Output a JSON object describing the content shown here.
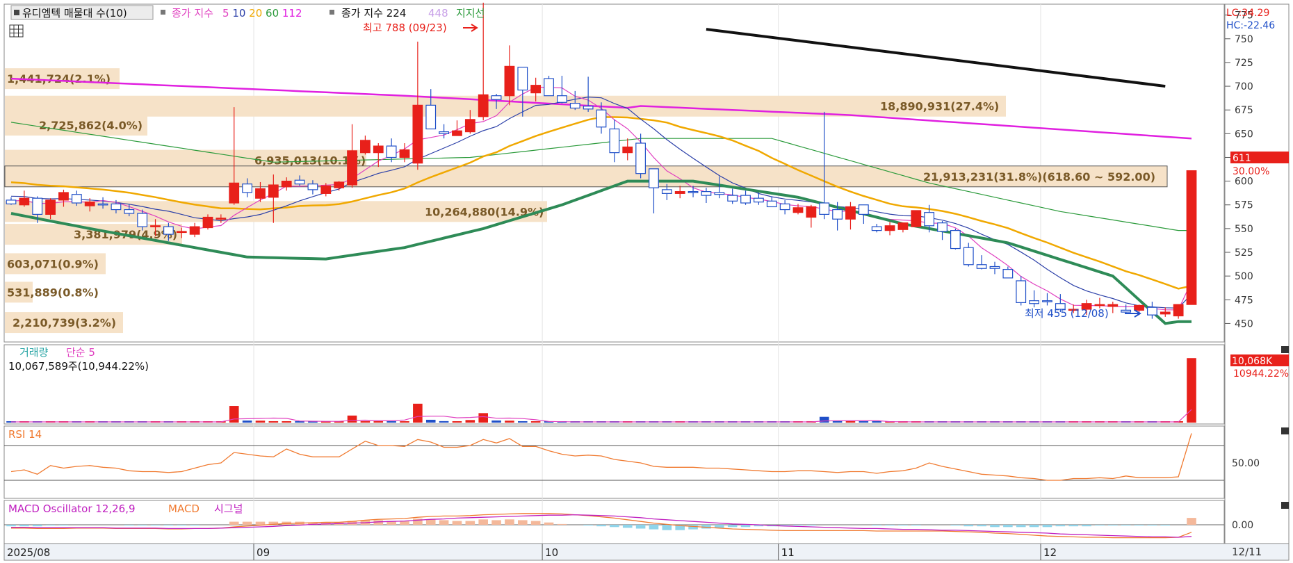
{
  "legend": {
    "title_button": "유디엠텍 매물대 수(10)",
    "ma_prefix": "종가 지수",
    "ma_periods": [
      "5",
      "10",
      "20",
      "60",
      "112"
    ],
    "ma_colors": [
      "#e040c0",
      "#2b3fa8",
      "#f0a800",
      "#2a9a3a",
      "#e020e0"
    ],
    "long_ma_label": "종가 지수 224",
    "long_ma_extra": "448",
    "support_label": "지지선"
  },
  "annotations": {
    "high_label": "최고 788 (09/23)",
    "low_label": "최저 455 (12/08)"
  },
  "lc_label": "LC:34.29",
  "hc_label": "HC:-22.46",
  "current_price": "611",
  "current_pct": "30.00%",
  "price_axis_ticks": [
    "775",
    "750",
    "725",
    "700",
    "675",
    "650",
    "625",
    "600",
    "575",
    "550",
    "525",
    "500",
    "475",
    "450"
  ],
  "volume_profile": [
    {
      "label": "1,441,724(2.1%)",
      "price": 708
    },
    {
      "label": "2,725,862(4.0%)",
      "price": 659
    },
    {
      "label": "6,935,013(10.1%)",
      "price": 622
    },
    {
      "label": "18,890,931(27.4%)",
      "price": 679
    },
    {
      "label": "21,913,231(31.8%)(618.60 ~ 592.00)",
      "price": 605
    },
    {
      "label": "10,264,880(14.9%)",
      "price": 568
    },
    {
      "label": "3,381,979(4.9%)",
      "price": 544
    },
    {
      "label": "603,071(0.9%)",
      "price": 513
    },
    {
      "label": "531,889(0.8%)",
      "price": 483
    },
    {
      "label": "2,210,739(3.2%)",
      "price": 451
    }
  ],
  "volume_panel": {
    "title": "거래량",
    "ma_label": "단순 5",
    "info": "10,067,589주(10,944.22%)",
    "last_label": "10,068K",
    "ma_value_label": "10944.22%"
  },
  "rsi_panel": {
    "title": "RSI 14",
    "level_label": "50.00"
  },
  "macd_panel": {
    "title": "MACD Oscillator 12,26,9",
    "macd_label": "MACD",
    "signal_label": "시그널",
    "zero_label": "0.00"
  },
  "x_axis_labels": [
    {
      "text": "2025/08",
      "idx": 0
    },
    {
      "text": "09",
      "idx": 19
    },
    {
      "text": "10",
      "idx": 41
    },
    {
      "text": "11",
      "idx": 59
    },
    {
      "text": "12",
      "idx": 79
    }
  ],
  "date_right": "12/11",
  "colors": {
    "up": "#e8201a",
    "down": "#1f4fc8",
    "ma224": "#e020e0",
    "ma60": "#2a9a3a",
    "ma20": "#f0a800",
    "ma10": "#2b3fa8",
    "ma5": "#e040c0",
    "support": "#111111",
    "green_band": "#2e8b57",
    "rsi": "#f07a30",
    "vp_bar": "#f6e2c8",
    "vp_text": "#7a5a28"
  },
  "chart_data": {
    "type": "candlestick",
    "candles": [
      {
        "o": 580,
        "h": 583,
        "l": 575,
        "c": 576
      },
      {
        "o": 575,
        "h": 590,
        "l": 573,
        "c": 582
      },
      {
        "o": 582,
        "h": 584,
        "l": 556,
        "c": 565
      },
      {
        "o": 565,
        "h": 582,
        "l": 560,
        "c": 580
      },
      {
        "o": 580,
        "h": 591,
        "l": 573,
        "c": 588
      },
      {
        "o": 586,
        "h": 590,
        "l": 574,
        "c": 577
      },
      {
        "o": 574,
        "h": 582,
        "l": 568,
        "c": 578
      },
      {
        "o": 576,
        "h": 583,
        "l": 571,
        "c": 575
      },
      {
        "o": 576,
        "h": 580,
        "l": 566,
        "c": 570
      },
      {
        "o": 570,
        "h": 576,
        "l": 563,
        "c": 566
      },
      {
        "o": 566,
        "h": 570,
        "l": 548,
        "c": 552
      },
      {
        "o": 552,
        "h": 560,
        "l": 542,
        "c": 553
      },
      {
        "o": 552,
        "h": 556,
        "l": 537,
        "c": 544
      },
      {
        "o": 546,
        "h": 551,
        "l": 540,
        "c": 547
      },
      {
        "o": 544,
        "h": 556,
        "l": 541,
        "c": 552
      },
      {
        "o": 551,
        "h": 565,
        "l": 549,
        "c": 562
      },
      {
        "o": 560,
        "h": 565,
        "l": 556,
        "c": 561
      },
      {
        "o": 577,
        "h": 678,
        "l": 575,
        "c": 598
      },
      {
        "o": 597,
        "h": 603,
        "l": 583,
        "c": 588
      },
      {
        "o": 582,
        "h": 599,
        "l": 578,
        "c": 592
      },
      {
        "o": 583,
        "h": 607,
        "l": 556,
        "c": 596
      },
      {
        "o": 594,
        "h": 604,
        "l": 590,
        "c": 600
      },
      {
        "o": 601,
        "h": 606,
        "l": 595,
        "c": 597
      },
      {
        "o": 597,
        "h": 601,
        "l": 586,
        "c": 591
      },
      {
        "o": 587,
        "h": 598,
        "l": 584,
        "c": 595
      },
      {
        "o": 593,
        "h": 600,
        "l": 590,
        "c": 599
      },
      {
        "o": 596,
        "h": 660,
        "l": 593,
        "c": 632
      },
      {
        "o": 630,
        "h": 648,
        "l": 628,
        "c": 643
      },
      {
        "o": 630,
        "h": 640,
        "l": 615,
        "c": 637
      },
      {
        "o": 637,
        "h": 645,
        "l": 620,
        "c": 625
      },
      {
        "o": 625,
        "h": 640,
        "l": 620,
        "c": 633
      },
      {
        "o": 619,
        "h": 747,
        "l": 612,
        "c": 680
      },
      {
        "o": 680,
        "h": 697,
        "l": 658,
        "c": 655
      },
      {
        "o": 652,
        "h": 660,
        "l": 645,
        "c": 650
      },
      {
        "o": 648,
        "h": 664,
        "l": 650,
        "c": 653
      },
      {
        "o": 652,
        "h": 675,
        "l": 650,
        "c": 665
      },
      {
        "o": 668,
        "h": 788,
        "l": 664,
        "c": 691
      },
      {
        "o": 690,
        "h": 692,
        "l": 676,
        "c": 686
      },
      {
        "o": 690,
        "h": 743,
        "l": 680,
        "c": 721
      },
      {
        "o": 720,
        "h": 720,
        "l": 668,
        "c": 696
      },
      {
        "o": 693,
        "h": 709,
        "l": 684,
        "c": 701
      },
      {
        "o": 708,
        "h": 711,
        "l": 690,
        "c": 690
      },
      {
        "o": 690,
        "h": 711,
        "l": 682,
        "c": 683
      },
      {
        "o": 682,
        "h": 695,
        "l": 675,
        "c": 677
      },
      {
        "o": 679,
        "h": 710,
        "l": 673,
        "c": 676
      },
      {
        "o": 675,
        "h": 683,
        "l": 650,
        "c": 657
      },
      {
        "o": 655,
        "h": 665,
        "l": 620,
        "c": 630
      },
      {
        "o": 630,
        "h": 645,
        "l": 622,
        "c": 636
      },
      {
        "o": 640,
        "h": 650,
        "l": 603,
        "c": 608
      },
      {
        "o": 613,
        "h": 611,
        "l": 566,
        "c": 593
      },
      {
        "o": 591,
        "h": 597,
        "l": 580,
        "c": 587
      },
      {
        "o": 587,
        "h": 595,
        "l": 582,
        "c": 589
      },
      {
        "o": 589,
        "h": 595,
        "l": 583,
        "c": 588
      },
      {
        "o": 589,
        "h": 593,
        "l": 577,
        "c": 585
      },
      {
        "o": 588,
        "h": 605,
        "l": 582,
        "c": 586
      },
      {
        "o": 585,
        "h": 592,
        "l": 576,
        "c": 579
      },
      {
        "o": 585,
        "h": 590,
        "l": 575,
        "c": 577
      },
      {
        "o": 582,
        "h": 588,
        "l": 575,
        "c": 578
      },
      {
        "o": 579,
        "h": 584,
        "l": 573,
        "c": 573
      },
      {
        "o": 576,
        "h": 580,
        "l": 565,
        "c": 570
      },
      {
        "o": 567,
        "h": 576,
        "l": 565,
        "c": 572
      },
      {
        "o": 562,
        "h": 575,
        "l": 551,
        "c": 573
      },
      {
        "o": 577,
        "h": 673,
        "l": 560,
        "c": 565
      },
      {
        "o": 570,
        "h": 578,
        "l": 548,
        "c": 560
      },
      {
        "o": 560,
        "h": 578,
        "l": 549,
        "c": 573
      },
      {
        "o": 575,
        "h": 575,
        "l": 555,
        "c": 565
      },
      {
        "o": 552,
        "h": 555,
        "l": 546,
        "c": 548
      },
      {
        "o": 548,
        "h": 557,
        "l": 543,
        "c": 553
      },
      {
        "o": 549,
        "h": 556,
        "l": 546,
        "c": 556
      },
      {
        "o": 552,
        "h": 562,
        "l": 552,
        "c": 569
      },
      {
        "o": 567,
        "h": 575,
        "l": 546,
        "c": 553
      },
      {
        "o": 556,
        "h": 558,
        "l": 538,
        "c": 547
      },
      {
        "o": 548,
        "h": 550,
        "l": 528,
        "c": 529
      },
      {
        "o": 530,
        "h": 535,
        "l": 510,
        "c": 512
      },
      {
        "o": 512,
        "h": 522,
        "l": 507,
        "c": 508
      },
      {
        "o": 510,
        "h": 515,
        "l": 502,
        "c": 508
      },
      {
        "o": 507,
        "h": 510,
        "l": 498,
        "c": 498
      },
      {
        "o": 495,
        "h": 500,
        "l": 469,
        "c": 472
      },
      {
        "o": 474,
        "h": 485,
        "l": 467,
        "c": 471
      },
      {
        "o": 474,
        "h": 482,
        "l": 469,
        "c": 473
      },
      {
        "o": 471,
        "h": 481,
        "l": 462,
        "c": 465
      },
      {
        "o": 465,
        "h": 470,
        "l": 461,
        "c": 465
      },
      {
        "o": 465,
        "h": 475,
        "l": 459,
        "c": 471
      },
      {
        "o": 469,
        "h": 477,
        "l": 466,
        "c": 470
      },
      {
        "o": 468,
        "h": 473,
        "l": 461,
        "c": 470
      },
      {
        "o": 464,
        "h": 470,
        "l": 461,
        "c": 462
      },
      {
        "o": 464,
        "h": 470,
        "l": 459,
        "c": 469
      },
      {
        "o": 467,
        "h": 473,
        "l": 455,
        "c": 459
      },
      {
        "o": 460,
        "h": 467,
        "l": 457,
        "c": 462
      },
      {
        "o": 458,
        "h": 466,
        "l": 455,
        "c": 470
      },
      {
        "o": 470,
        "h": 611,
        "l": 470,
        "c": 611
      }
    ],
    "volume_k": [
      120,
      40,
      35,
      150,
      60,
      70,
      30,
      30,
      30,
      25,
      40,
      30,
      50,
      40,
      40,
      35,
      90,
      2600,
      320,
      300,
      220,
      190,
      150,
      160,
      150,
      140,
      1100,
      230,
      200,
      150,
      160,
      2950,
      440,
      230,
      210,
      400,
      1480,
      330,
      300,
      100,
      100,
      80,
      60,
      70,
      60,
      70,
      100,
      90,
      70,
      70,
      90,
      70,
      60,
      40,
      40,
      60,
      40,
      50,
      40,
      40,
      80,
      220,
      900,
      250,
      160,
      120,
      80,
      80,
      70,
      60,
      60,
      60,
      40,
      70,
      60,
      30,
      40,
      40,
      60,
      40,
      40,
      60,
      40,
      40,
      30,
      40,
      40,
      40,
      30,
      30,
      10068
    ],
    "volume_ma5_k": [
      60,
      65,
      70,
      90,
      80,
      75,
      70,
      60,
      50,
      45,
      40,
      40,
      45,
      45,
      45,
      45,
      55,
      560,
      610,
      650,
      700,
      660,
      250,
      220,
      200,
      190,
      350,
      380,
      330,
      330,
      400,
      950,
      1000,
      1000,
      750,
      800,
      930,
      680,
      710,
      630,
      450,
      180,
      140,
      90,
      80,
      75,
      70,
      80,
      80,
      80,
      80,
      80,
      70,
      60,
      60,
      55,
      50,
      50,
      45,
      50,
      55,
      90,
      260,
      290,
      320,
      330,
      310,
      150,
      120,
      90,
      80,
      70,
      60,
      60,
      60,
      55,
      55,
      50,
      50,
      45,
      45,
      45,
      45,
      45,
      40,
      40,
      40,
      40,
      38,
      35,
      2040
    ],
    "rsi": [
      40,
      42,
      37,
      47,
      44,
      46,
      47,
      45,
      44,
      41,
      40,
      40,
      39,
      40,
      44,
      48,
      50,
      62,
      60,
      58,
      57,
      66,
      60,
      57,
      57,
      57,
      66,
      75,
      70,
      70,
      69,
      77,
      74,
      68,
      68,
      70,
      77,
      73,
      78,
      69,
      69,
      64,
      60,
      58,
      59,
      58,
      54,
      52,
      50,
      46,
      45,
      45,
      45,
      44,
      44,
      43,
      42,
      41,
      40,
      40,
      41,
      41,
      40,
      39,
      40,
      40,
      38,
      40,
      41,
      44,
      50,
      46,
      43,
      40,
      37,
      36,
      35,
      33,
      32,
      30,
      30,
      32,
      32,
      33,
      32,
      35,
      33,
      33,
      33,
      34,
      84
    ],
    "macd_osc": [
      -2,
      -2,
      -2,
      -1,
      -1,
      0,
      0,
      0,
      0,
      -1,
      -1,
      -1,
      -1,
      -1,
      -1,
      0,
      0,
      4,
      4,
      4,
      4,
      4,
      4,
      3,
      3,
      3,
      5,
      6,
      6,
      5,
      5,
      8,
      7,
      6,
      5,
      5,
      7,
      6,
      7,
      6,
      5,
      3,
      1,
      0,
      -1,
      -2,
      -3,
      -4,
      -5,
      -6,
      -7,
      -7,
      -6,
      -5,
      -4,
      -3,
      -3,
      -2,
      -2,
      -1,
      -1,
      -1,
      0,
      0,
      0,
      0,
      -1,
      -1,
      -1,
      -1,
      0,
      0,
      -1,
      -2,
      -2,
      -3,
      -3,
      -3,
      -3,
      -3,
      -2,
      -2,
      -2,
      -1,
      -1,
      -1,
      -1,
      -1,
      -1,
      0,
      9
    ],
    "macd": [
      -8,
      -8,
      -9,
      -9,
      -9,
      -8,
      -8,
      -8,
      -9,
      -9,
      -9,
      -9,
      -10,
      -10,
      -9,
      -9,
      -8,
      -5,
      -3,
      -1,
      1,
      3,
      4,
      5,
      6,
      6,
      8,
      11,
      13,
      14,
      15,
      18,
      20,
      21,
      21,
      22,
      24,
      25,
      26,
      27,
      27,
      27,
      26,
      24,
      22,
      19,
      16,
      12,
      8,
      4,
      1,
      -2,
      -4,
      -6,
      -8,
      -10,
      -11,
      -12,
      -13,
      -14,
      -14,
      -14,
      -14,
      -14,
      -14,
      -14,
      -15,
      -15,
      -15,
      -15,
      -15,
      -15,
      -16,
      -17,
      -18,
      -20,
      -21,
      -23,
      -25,
      -27,
      -28,
      -29,
      -30,
      -30,
      -31,
      -31,
      -31,
      -31,
      -31,
      -30,
      -18
    ],
    "macd_signal": [
      -6,
      -6,
      -7,
      -7,
      -7,
      -7,
      -7,
      -7,
      -8,
      -8,
      -8,
      -8,
      -9,
      -9,
      -9,
      -9,
      -8,
      -7,
      -6,
      -5,
      -4,
      -2,
      -1,
      1,
      2,
      3,
      4,
      5,
      7,
      8,
      9,
      11,
      13,
      14,
      16,
      17,
      18,
      19,
      20,
      21,
      22,
      23,
      23,
      24,
      23,
      22,
      21,
      19,
      17,
      14,
      12,
      10,
      8,
      6,
      4,
      2,
      1,
      0,
      -2,
      -3,
      -4,
      -5,
      -6,
      -7,
      -8,
      -9,
      -9,
      -10,
      -11,
      -11,
      -12,
      -13,
      -13,
      -14,
      -15,
      -16,
      -17,
      -18,
      -19,
      -20,
      -22,
      -23,
      -24,
      -25,
      -26,
      -27,
      -28,
      -29,
      -29,
      -30,
      -28
    ],
    "support_line": {
      "start_idx": 53,
      "start_price": 760,
      "end_idx": 88,
      "end_price": 700
    },
    "price_axis_range": [
      432,
      785
    ]
  }
}
